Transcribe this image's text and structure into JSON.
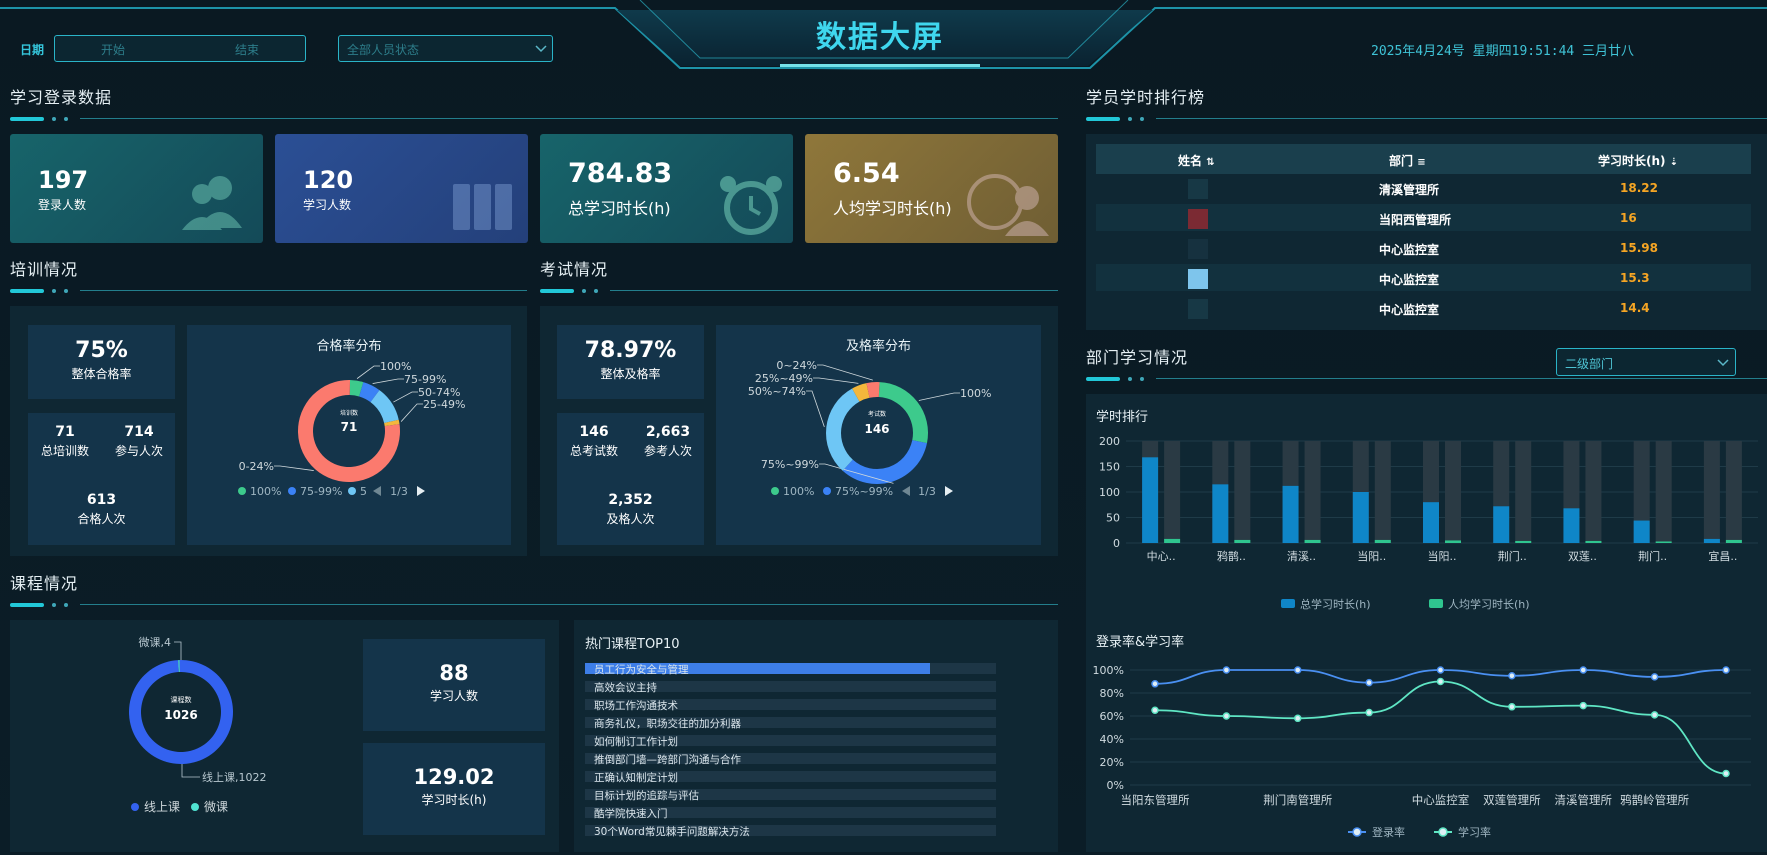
{
  "header": {
    "title": "数据大屏",
    "date_label": "日期",
    "start_placeholder": "开始",
    "end_placeholder": "结束",
    "status_select": "全部人员状态",
    "datetime": "2025年4月24号 星期四19:51:44 三月廿八"
  },
  "login": {
    "title": "学习登录数据",
    "cards": [
      {
        "value": "197",
        "label": "登录人数",
        "icon": "users-icon",
        "color": "#1b5f66"
      },
      {
        "value": "120",
        "label": "学习人数",
        "icon": "books-icon",
        "color": "#27488a"
      },
      {
        "value": "784.83",
        "label": "总学习时长(h)",
        "icon": "alarm-clock-icon",
        "color": "#1b5f66"
      },
      {
        "value": "6.54",
        "label": "人均学习时长(h)",
        "icon": "clock-user-icon",
        "color": "#86703a"
      }
    ]
  },
  "training": {
    "title": "培训情况",
    "rate_value": "75%",
    "rate_label": "整体合格率",
    "total_value": "71",
    "total_label": "总培训数",
    "join_value": "714",
    "join_label": "参与人次",
    "pass_value": "613",
    "pass_label": "合格人次",
    "chart_title": "合格率分布",
    "center_label": "培训数",
    "center_value": "71",
    "page": "1/3",
    "legend": [
      "100%",
      "75-99%",
      "5"
    ]
  },
  "exam": {
    "title": "考试情况",
    "rate_value": "78.97%",
    "rate_label": "整体及格率",
    "total_value": "146",
    "total_label": "总考试数",
    "join_value": "2,663",
    "join_label": "参考人次",
    "pass_value": "2,352",
    "pass_label": "及格人次",
    "chart_title": "及格率分布",
    "center_label": "考试数",
    "center_value": "146",
    "page": "1/3",
    "legend": [
      "100%",
      "75%~99%"
    ]
  },
  "course": {
    "title": "课程情况",
    "center_label": "课程数",
    "center_value": "1026",
    "micro_label": "微课,4",
    "online_label": "线上课,1022",
    "legend_online": "线上课",
    "legend_micro": "微课",
    "learners_value": "88",
    "learners_label": "学习人数",
    "hours_value": "129.02",
    "hours_label": "学习时长(h)",
    "hot_title": "热门课程TOP10",
    "hot_courses": [
      {
        "name": "员工行为安全与管理",
        "pct": 84
      },
      {
        "name": "高效会议主持",
        "pct": 0
      },
      {
        "name": "职场工作沟通技术",
        "pct": 0
      },
      {
        "name": "商务礼仪，职场交往的加分利器",
        "pct": 0
      },
      {
        "name": "如何制订工作计划",
        "pct": 0
      },
      {
        "name": "推倒部门墙—跨部门沟通与合作",
        "pct": 0
      },
      {
        "name": "正确认知制定计划",
        "pct": 0
      },
      {
        "name": "目标计划的追踪与评估",
        "pct": 0
      },
      {
        "name": "酷学院快速入门",
        "pct": 0
      },
      {
        "name": "30个Word常见棘手问题解决方法",
        "pct": 0
      }
    ]
  },
  "ranking": {
    "title": "学员学时排行榜",
    "col_name": "姓名",
    "col_dept": "部门",
    "col_hours": "学习时长(h)",
    "rows": [
      {
        "dept": "清溪管理所",
        "hours": "18.22"
      },
      {
        "dept": "当阳西管理所",
        "hours": "16"
      },
      {
        "dept": "中心监控室",
        "hours": "15.98"
      },
      {
        "dept": "中心监控室",
        "hours": "15.3"
      },
      {
        "dept": "中心监控室",
        "hours": "14.4"
      }
    ]
  },
  "dept": {
    "title": "部门学习情况",
    "level_select": "二级部门",
    "bar_title": "学时排行",
    "line_title": "登录率&学习率"
  },
  "chart_data": [
    {
      "type": "pie",
      "title": "合格率分布",
      "labels": [
        "100%",
        "75-99%",
        "50-74%",
        "25-49%",
        "0-24%"
      ],
      "values": [
        3,
        4,
        8,
        1,
        55
      ],
      "colors": [
        "#3dca8c",
        "#3b82f6",
        "#6ec6f5",
        "#f3b73c",
        "#fb7a6e"
      ]
    },
    {
      "type": "pie",
      "title": "及格率分布",
      "labels": [
        "100%",
        "75%~99%",
        "50%~74%",
        "25%~49%",
        "0~24%"
      ],
      "values": [
        40,
        49,
        44,
        7,
        6
      ],
      "colors": [
        "#3dca8c",
        "#3b82f6",
        "#6ec6f5",
        "#f3b73c",
        "#fb7a6e"
      ]
    },
    {
      "type": "pie",
      "title": "",
      "labels": [
        "线上课",
        "微课"
      ],
      "values": [
        1022,
        4
      ],
      "colors": [
        "#3362f0",
        "#50e3d2"
      ]
    },
    {
      "type": "bar",
      "title": "学时排行",
      "categories": [
        "中心..",
        "鸦鹊..",
        "清溪..",
        "当阳..",
        "当阳..",
        "荆门..",
        "双莲..",
        "荆门..",
        "宜昌.."
      ],
      "series": [
        {
          "name": "总学习时长(h)",
          "values": [
            168,
            115,
            112,
            100,
            80,
            72,
            68,
            44,
            8
          ]
        },
        {
          "name": "人均学习时长(h)",
          "values": [
            8,
            6,
            6,
            6,
            5,
            4,
            4,
            3,
            6
          ]
        }
      ],
      "ylim": [
        0,
        200
      ],
      "yticks": [
        0,
        50,
        100,
        150,
        200
      ],
      "colors": [
        "#0f86c8",
        "#2fc58f"
      ]
    },
    {
      "type": "line",
      "title": "登录率&学习率",
      "categories": [
        "当阳东管理所",
        "",
        "荆门南管理所",
        "",
        "中心监控室",
        "双莲管理所",
        "清溪管理所",
        "鸦鹊岭管理所",
        ""
      ],
      "series": [
        {
          "name": "登录率",
          "values": [
            88,
            100,
            100,
            89,
            100,
            95,
            100,
            94,
            100
          ]
        },
        {
          "name": "学习率",
          "values": [
            65,
            60,
            58,
            63,
            90,
            68,
            69,
            61,
            10
          ]
        }
      ],
      "yticks": [
        "0%",
        "20%",
        "40%",
        "60%",
        "80%",
        "100%"
      ],
      "ylim": [
        0,
        100
      ],
      "colors": [
        "#4a90f2",
        "#5fe6c4"
      ]
    }
  ]
}
